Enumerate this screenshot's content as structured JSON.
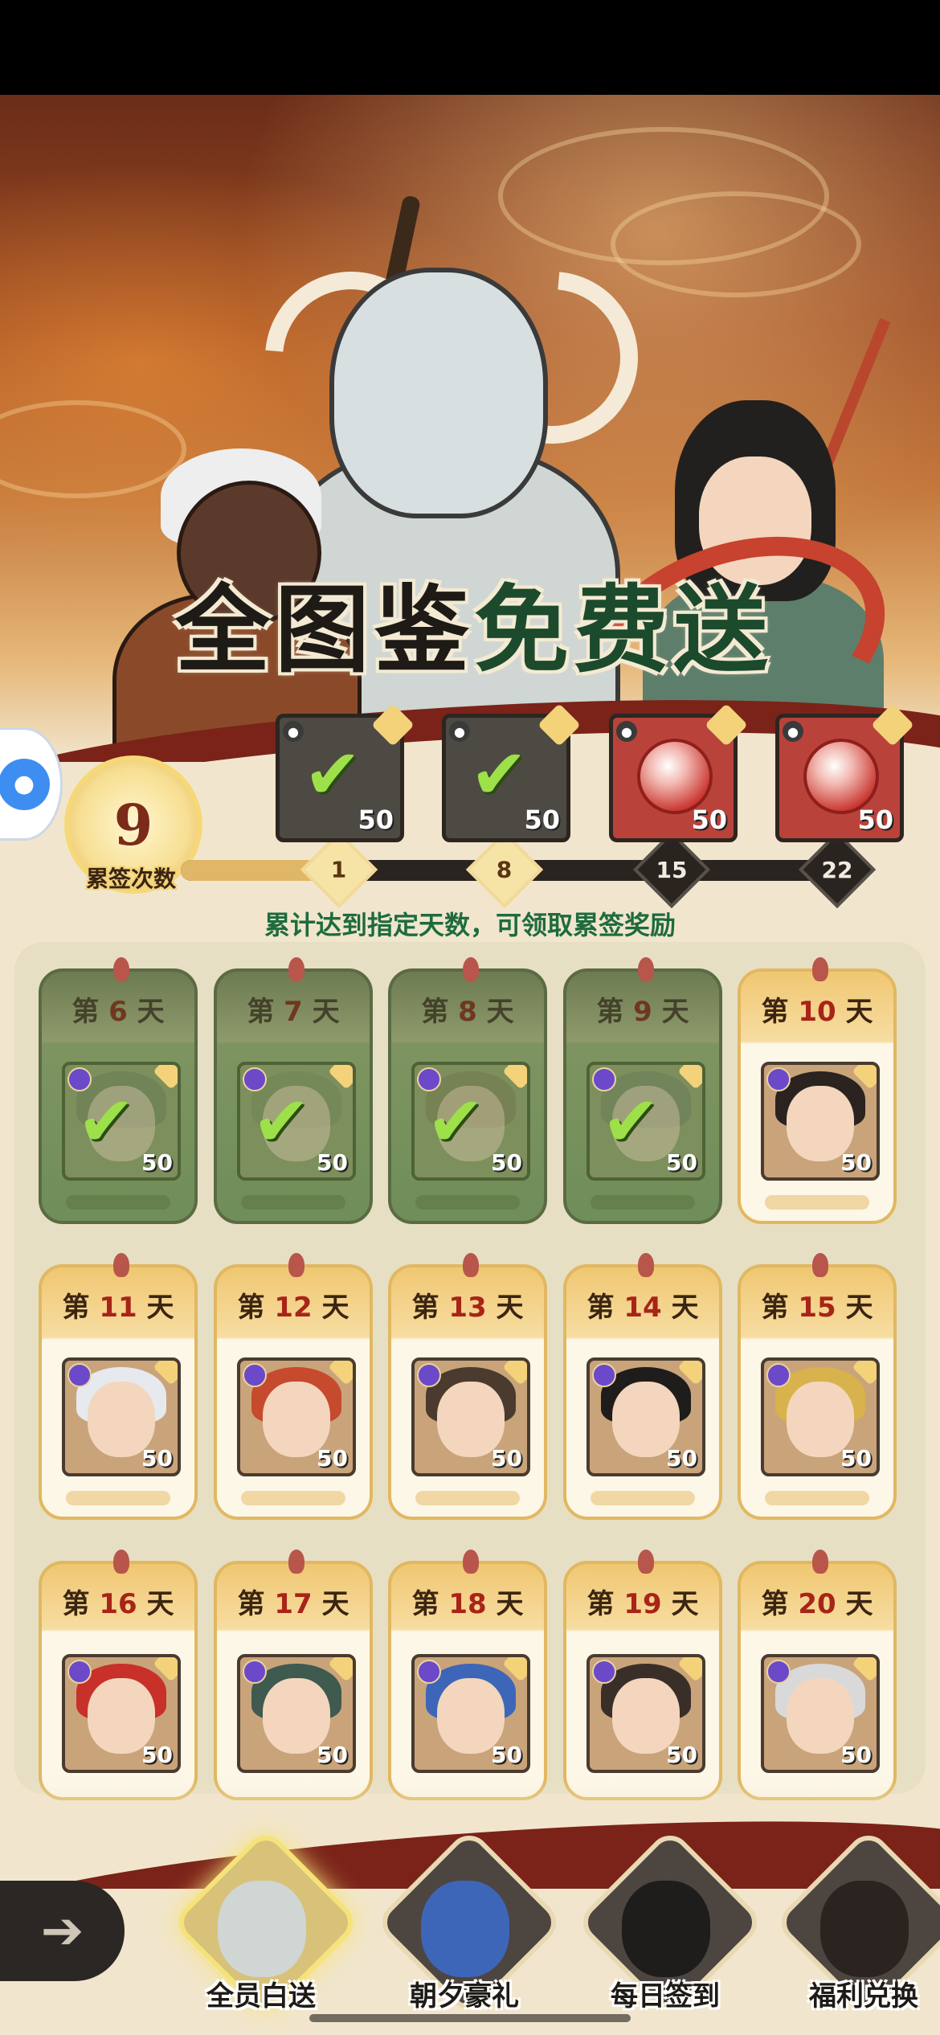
{
  "banner": {
    "title_part1": "全图鉴",
    "title_part2": "免费送"
  },
  "cumulative": {
    "count": "9",
    "label": "累签次数",
    "progress_fraction": 0.28,
    "milestones": [
      {
        "day": "1",
        "reached": true
      },
      {
        "day": "8",
        "reached": true
      },
      {
        "day": "15",
        "reached": false
      },
      {
        "day": "22",
        "reached": false
      }
    ],
    "rewards": [
      {
        "amount": "50",
        "claimed": true
      },
      {
        "amount": "50",
        "claimed": true
      },
      {
        "amount": "50",
        "claimed": false
      },
      {
        "amount": "50",
        "claimed": false
      }
    ],
    "hint": "累计达到指定天数，可领取累签奖励"
  },
  "days": [
    {
      "prefix": "第",
      "num": "6",
      "suffix": "天",
      "amount": "50",
      "claimed": true,
      "hair": "#5b6f4f"
    },
    {
      "prefix": "第",
      "num": "7",
      "suffix": "天",
      "amount": "50",
      "claimed": true,
      "hair": "#6b7a4f"
    },
    {
      "prefix": "第",
      "num": "8",
      "suffix": "天",
      "amount": "50",
      "claimed": true,
      "hair": "#6f6a46"
    },
    {
      "prefix": "第",
      "num": "9",
      "suffix": "天",
      "amount": "50",
      "claimed": true,
      "hair": "#5f6f56"
    },
    {
      "prefix": "第",
      "num": "10",
      "suffix": "天",
      "amount": "50",
      "claimed": false,
      "hair": "#2a2320"
    },
    {
      "prefix": "第",
      "num": "11",
      "suffix": "天",
      "amount": "50",
      "claimed": false,
      "hair": "#e6e9ee"
    },
    {
      "prefix": "第",
      "num": "12",
      "suffix": "天",
      "amount": "50",
      "claimed": false,
      "hair": "#c64a2e"
    },
    {
      "prefix": "第",
      "num": "13",
      "suffix": "天",
      "amount": "50",
      "claimed": false,
      "hair": "#4a3b2e"
    },
    {
      "prefix": "第",
      "num": "14",
      "suffix": "天",
      "amount": "50",
      "claimed": false,
      "hair": "#1f1c1c"
    },
    {
      "prefix": "第",
      "num": "15",
      "suffix": "天",
      "amount": "50",
      "claimed": false,
      "hair": "#d8b24c"
    },
    {
      "prefix": "第",
      "num": "16",
      "suffix": "天",
      "amount": "50",
      "claimed": false,
      "hair": "#c8302a"
    },
    {
      "prefix": "第",
      "num": "17",
      "suffix": "天",
      "amount": "50",
      "claimed": false,
      "hair": "#3f5a4f"
    },
    {
      "prefix": "第",
      "num": "18",
      "suffix": "天",
      "amount": "50",
      "claimed": false,
      "hair": "#3d66b8"
    },
    {
      "prefix": "第",
      "num": "19",
      "suffix": "天",
      "amount": "50",
      "claimed": false,
      "hair": "#3a2f28"
    },
    {
      "prefix": "第",
      "num": "20",
      "suffix": "天",
      "amount": "50",
      "claimed": false,
      "hair": "#d9d9d9"
    }
  ],
  "bottom_nav": [
    {
      "label": "全员白送",
      "active": true,
      "color": "#cfd6d3"
    },
    {
      "label": "朝夕豪礼",
      "active": false,
      "color": "#3d66b8"
    },
    {
      "label": "每日签到",
      "active": false,
      "color": "#1f1c1c"
    },
    {
      "label": "福利兑换",
      "active": false,
      "color": "#2a2320"
    }
  ],
  "colors": {
    "accent_gold": "#e0b767",
    "claimed_green": "#7e9460",
    "hint_green": "#1e6b3e",
    "day_red": "#a82418"
  },
  "icons": {
    "back": "arrow-left-icon",
    "float": "gamepad-icon",
    "claimed": "checkmark-icon"
  }
}
